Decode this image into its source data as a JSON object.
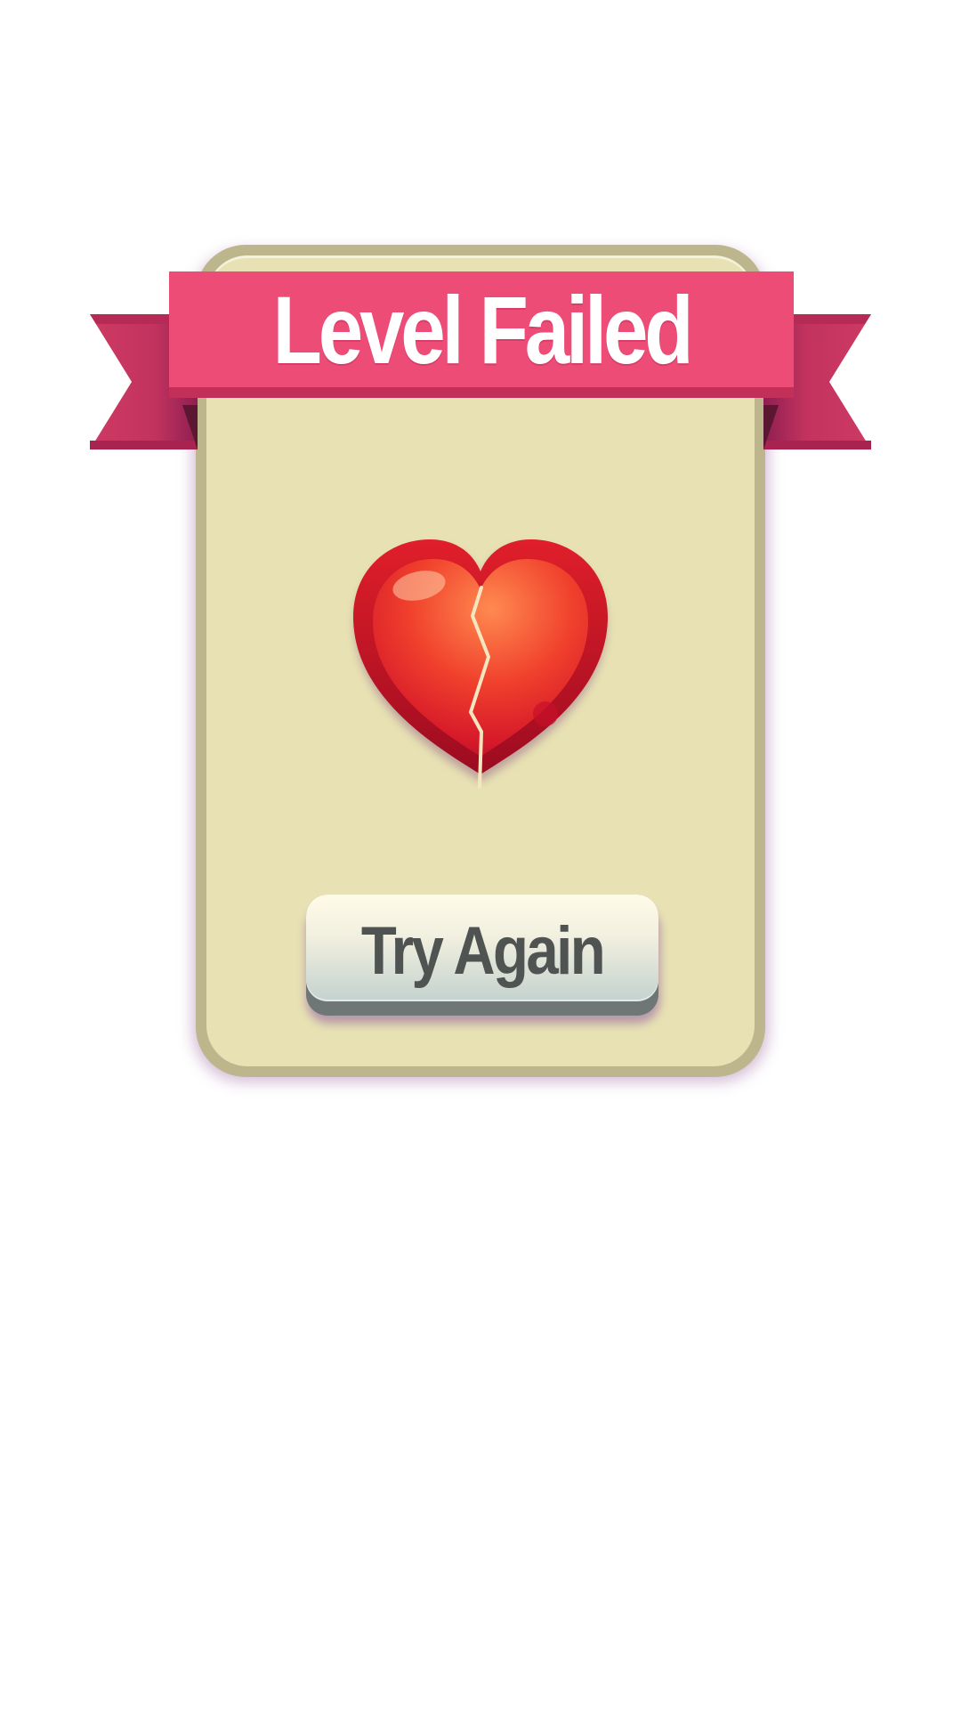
{
  "dialog": {
    "title": "Level Failed",
    "status": "failed",
    "icon": "broken-heart-icon",
    "primary_button": {
      "label": "Try Again"
    }
  },
  "colors": {
    "ribbon": "#ec4c76",
    "ribbon_tail": "#c3335f",
    "panel_border": "#bdb68c",
    "panel_fill": "#e7e1b3",
    "heart": "#e8282c",
    "button_text": "#4f5352"
  }
}
